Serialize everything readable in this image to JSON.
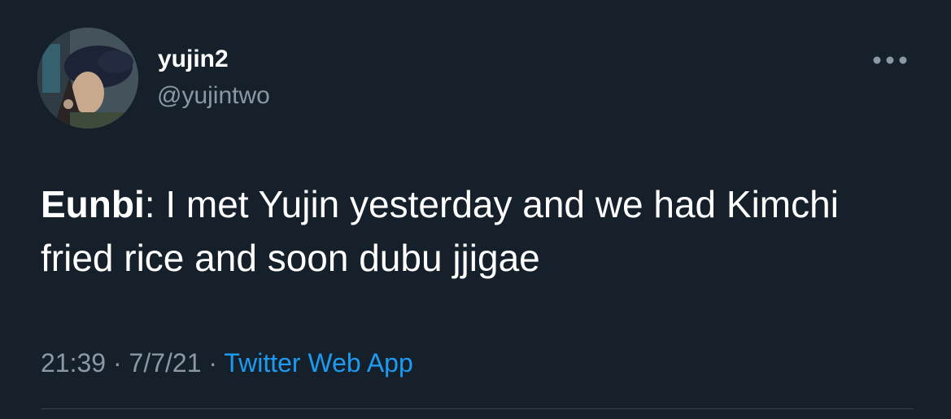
{
  "tweet": {
    "display_name": "yujin2",
    "handle": "@yujintwo",
    "more_icon": "more-horizontal-icon",
    "speaker": "Eunbi",
    "colon": ":",
    "text": " I met Yujin yesterday and we had Kimchi fried rice and soon dubu jjigae",
    "time": "21:39",
    "separator": " · ",
    "date": "7/7/21",
    "source": "Twitter Web App"
  },
  "colors": {
    "background": "#15202b",
    "primary_text": "#ffffff",
    "secondary_text": "#8b98a5",
    "link": "#1d9bf0",
    "divider": "#38444d"
  }
}
